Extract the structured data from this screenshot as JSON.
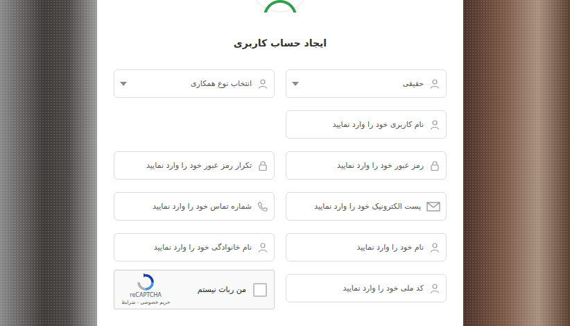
{
  "title": "ایجاد حساب کاربری",
  "rows": [
    [
      {
        "kind": "select",
        "text": "حقیقی"
      },
      {
        "kind": "select",
        "text": "انتخاب نوع همکاری"
      }
    ],
    [
      {
        "kind": "text",
        "text": "نام کاربری خود را وارد نمایید"
      }
    ],
    [
      {
        "kind": "password",
        "text": "رمز عبور خود را وارد نمایید"
      },
      {
        "kind": "password",
        "text": "تکرار رمز عبور خود را وارد نمایید"
      }
    ],
    [
      {
        "kind": "email",
        "text": "پست الکترونیک خود را وارد نمایید"
      },
      {
        "kind": "phone",
        "text": "شماره تماس خود را وارد نمایید"
      }
    ],
    [
      {
        "kind": "text",
        "text": "نام خود را وارد نمایید"
      },
      {
        "kind": "text",
        "text": "نام خانوادگی خود را وارد نمایید"
      }
    ],
    [
      {
        "kind": "text",
        "text": "کد ملی خود را وارد نمایید"
      },
      {
        "kind": "captcha",
        "label": "من ربات نیستم",
        "checked": false,
        "brand": "reCAPTCHA",
        "links": "حریم خصوصی - شرایط"
      }
    ]
  ]
}
